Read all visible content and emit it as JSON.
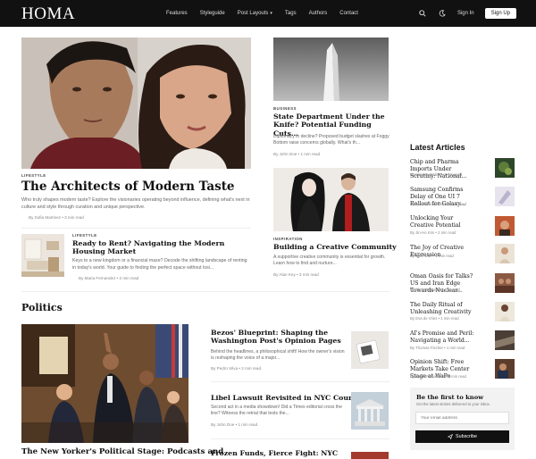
{
  "nav": {
    "logo": "HOMA",
    "items": [
      "Features",
      "Styleguide",
      "Post Layouts",
      "Tags",
      "Authors",
      "Contact"
    ],
    "sign_in": "Sign In",
    "sign_up": "Sign Up",
    "icons": [
      "search-icon",
      "moon-icon"
    ]
  },
  "hero": {
    "tag": "LIFESTYLE",
    "title": "The Architects of Modern Taste",
    "excerpt": "Who truly shapes modern taste? Explore the visionaries operating beyond influence, defining what's next in culture and style through curation and unique perspective.",
    "meta": "By Sofia Martinez • 3 min read"
  },
  "side_post": {
    "tag": "LIFESTYLE",
    "title": "Ready to Rent? Navigating the Modern Housing Market",
    "excerpt": "Keys to a new kingdom or a financial maze? Decode the shifting landscape of renting in today's world. Your guide to finding the perfect space without losi...",
    "meta": "By Maria Fernandez • 2 min read"
  },
  "mid_posts": [
    {
      "tag": "BUSINESS",
      "title": "State Department Under the Knife? Potential Funding Cuts...",
      "excerpt": "Diplomacy in decline? Proposed budget slashes at Foggy Bottom raise concerns globally. What's th...",
      "meta": "By John Doe • 1 min read"
    },
    {
      "tag": "INSPIRATION",
      "title": "Building a Creative Community",
      "excerpt": "A supportive creative community is essential for growth. Learn how to find and nurture...",
      "meta": "By Alan Key • 3 min read"
    }
  ],
  "latest": {
    "heading": "Latest Articles",
    "items": [
      {
        "title": "Chip and Pharma Imports Under Scrutiny: National...",
        "meta": "By Marcus Weber • 1 min read"
      },
      {
        "title": "Samsung Confirms Delay of One UI 7 Rollout for Galaxy...",
        "meta": "By Maria Fernandez • 2 min read"
      },
      {
        "title": "Unlocking Your Creative Potential",
        "meta": "By Jin-Ho Kim • 2 min read"
      },
      {
        "title": "The Joy of Creative Expression",
        "meta": "By John Doe • 1 min read"
      },
      {
        "title": "Oman Oasis for Talks? US and Iran Edge Towards Nuclear...",
        "meta": "By Ahmed Shaw • 2 min read"
      },
      {
        "title": "The Daily Ritual of Unleashing Creativity",
        "meta": "By Eva de Vries • 1 min read"
      },
      {
        "title": "AI's Promise and Peril: Navigating a World...",
        "meta": "By Thomas Fischer • 1 min read"
      },
      {
        "title": "Opinion Shift: Free Markets Take Center Stage at WaPo",
        "meta": "By Maria Fernandez • 1 min read"
      }
    ]
  },
  "newsletter": {
    "title": "Be the first to know",
    "subtitle": "Get the latest stories delivered to your inbox.",
    "placeholder": "Your email address",
    "button": "Subscribe"
  },
  "politics": {
    "heading": "Politics",
    "main_title": "The New Yorker's Political Stage: Podcasts and",
    "posts": [
      {
        "title": "Bezos' Blueprint: Shaping the Washington Post's Opinion Pages",
        "excerpt": "Behind the headlines, a philosophical shift! How the owner's vision is reshaping the voice of a major...",
        "meta": "By Pedro Silva • 2 min read"
      },
      {
        "title": "Libel Lawsuit Revisited in NYC Court",
        "excerpt": "Second act in a media showdown! Did a Times editorial cross the line? Witness the retrial that tests the...",
        "meta": "By John Doe • 1 min read"
      },
      {
        "title": "Frozen Funds, Fierce Fight: NYC",
        "excerpt": "",
        "meta": ""
      }
    ]
  },
  "colors": {
    "nav_bg": "#111111",
    "text": "#111111",
    "muted": "#888888"
  }
}
